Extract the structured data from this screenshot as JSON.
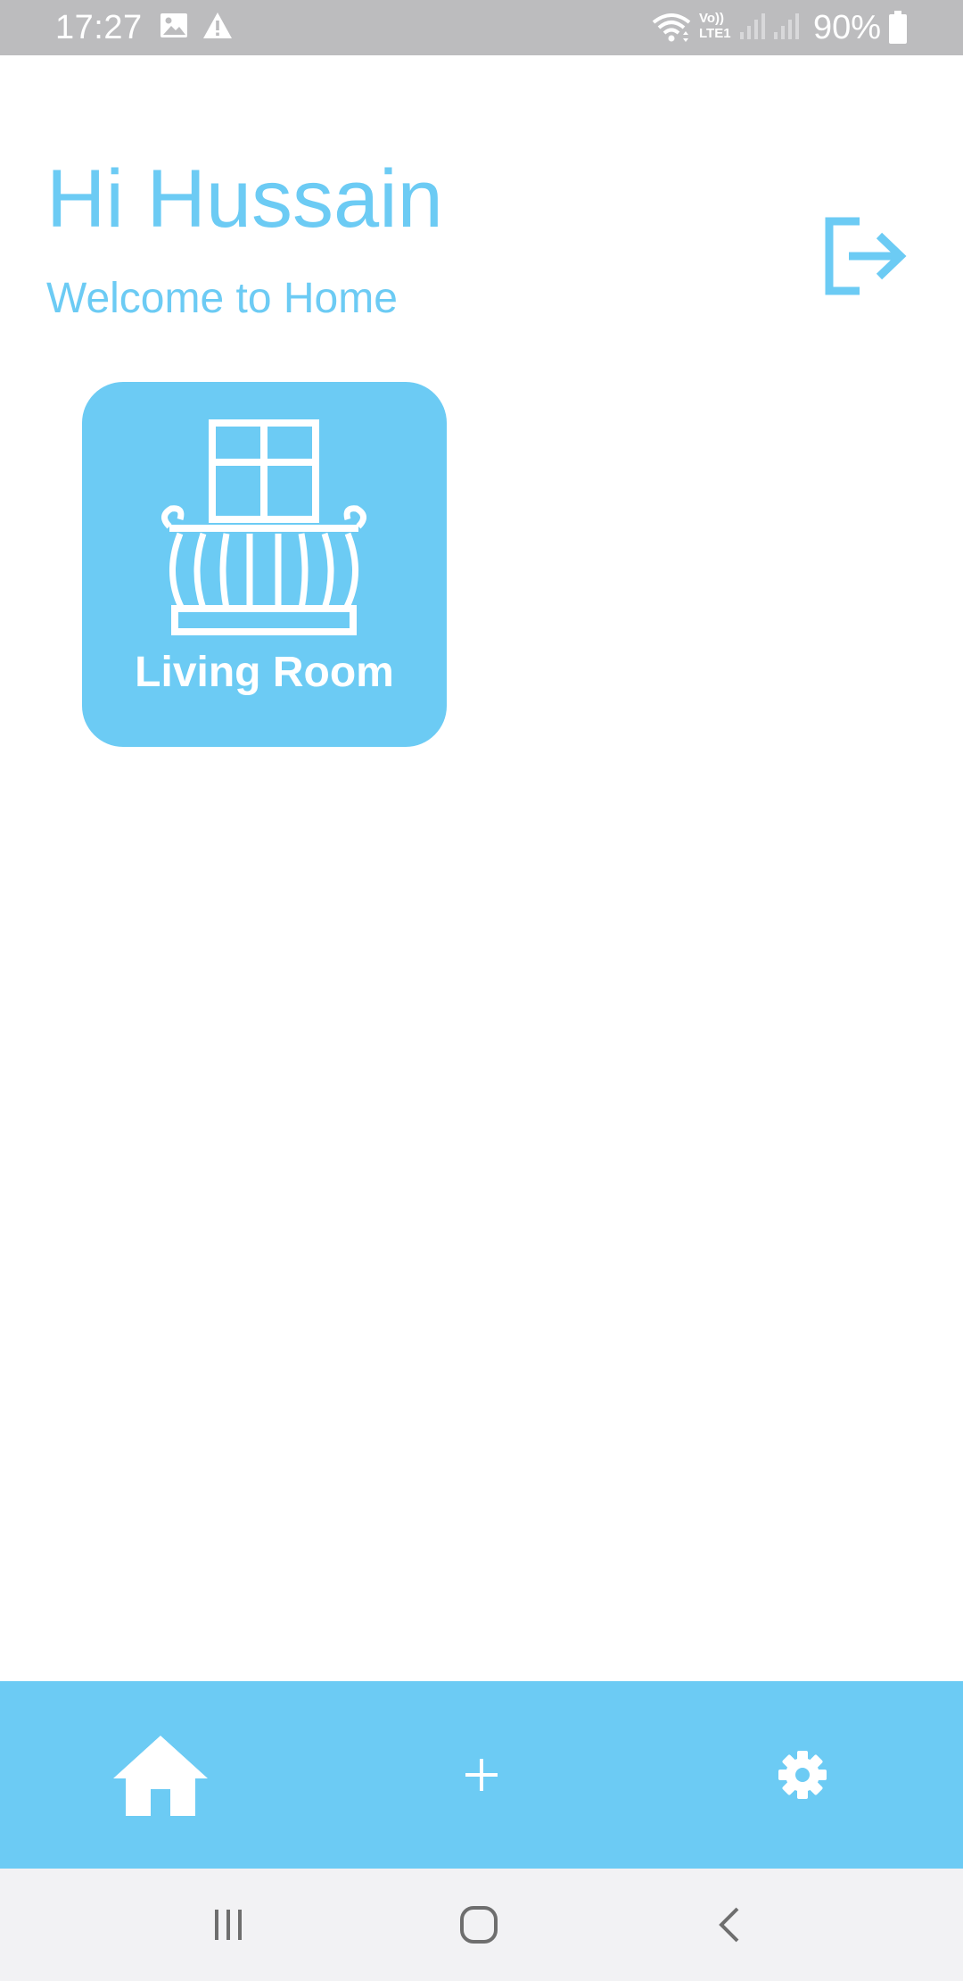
{
  "status_bar": {
    "time": "17:27",
    "battery": "90%",
    "icons": [
      "image-icon",
      "warning-icon",
      "wifi-icon",
      "volte-lte-icon",
      "signal-icon",
      "signal-icon",
      "battery-icon"
    ],
    "volte_top": "Vo))",
    "volte_bottom": "LTE1"
  },
  "header": {
    "greeting": "Hi Hussain",
    "subtitle": "Welcome to Home",
    "logout_icon": "logout-icon"
  },
  "rooms": [
    {
      "label": "Living Room",
      "icon": "balcony-icon"
    }
  ],
  "bottom_nav": {
    "items": [
      {
        "icon": "home-icon",
        "selected": true
      },
      {
        "icon": "plus-icon",
        "selected": false
      },
      {
        "icon": "gear-icon",
        "selected": false
      }
    ]
  },
  "system_nav": {
    "items": [
      "recents-icon",
      "home-circle-icon",
      "back-icon"
    ]
  },
  "colors": {
    "accent": "#6ccbf4",
    "status_bar": "#bcbcbe",
    "system_bar": "#f2f2f4",
    "system_icons": "#6e6e6e"
  }
}
